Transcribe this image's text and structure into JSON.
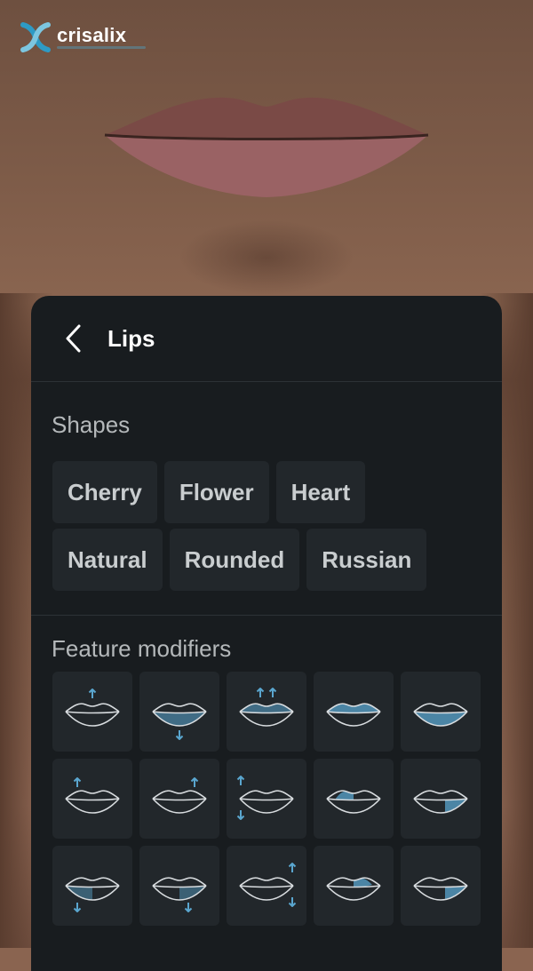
{
  "brand": {
    "name": "crisalix"
  },
  "panel": {
    "title": "Lips",
    "shapes_title": "Shapes",
    "shapes": [
      [
        "Cherry",
        "Flower",
        "Heart"
      ],
      [
        "Natural",
        "Rounded",
        "Russian"
      ]
    ],
    "modifiers_title": "Feature modifiers",
    "modifiers": [
      [
        "upper-lip-up-icon",
        "lower-lip-down-icon",
        "both-lips-up-icon",
        "upper-lip-fill-icon",
        "lower-lip-fill-icon"
      ],
      [
        "left-corner-up-icon",
        "right-corner-up-icon",
        "lip-height-adjust-icon",
        "upper-left-fill-icon",
        "lower-right-fill-icon"
      ],
      [
        "left-lower-down-icon",
        "right-lower-down-icon",
        "right-height-adjust-icon",
        "upper-right-fill-icon",
        "lower-right-corner-fill-icon"
      ]
    ]
  },
  "colors": {
    "panel_bg": "#181c1f",
    "tile_bg": "#22272b",
    "accent": "#5aa6cf",
    "text": "#c9cdcf"
  }
}
